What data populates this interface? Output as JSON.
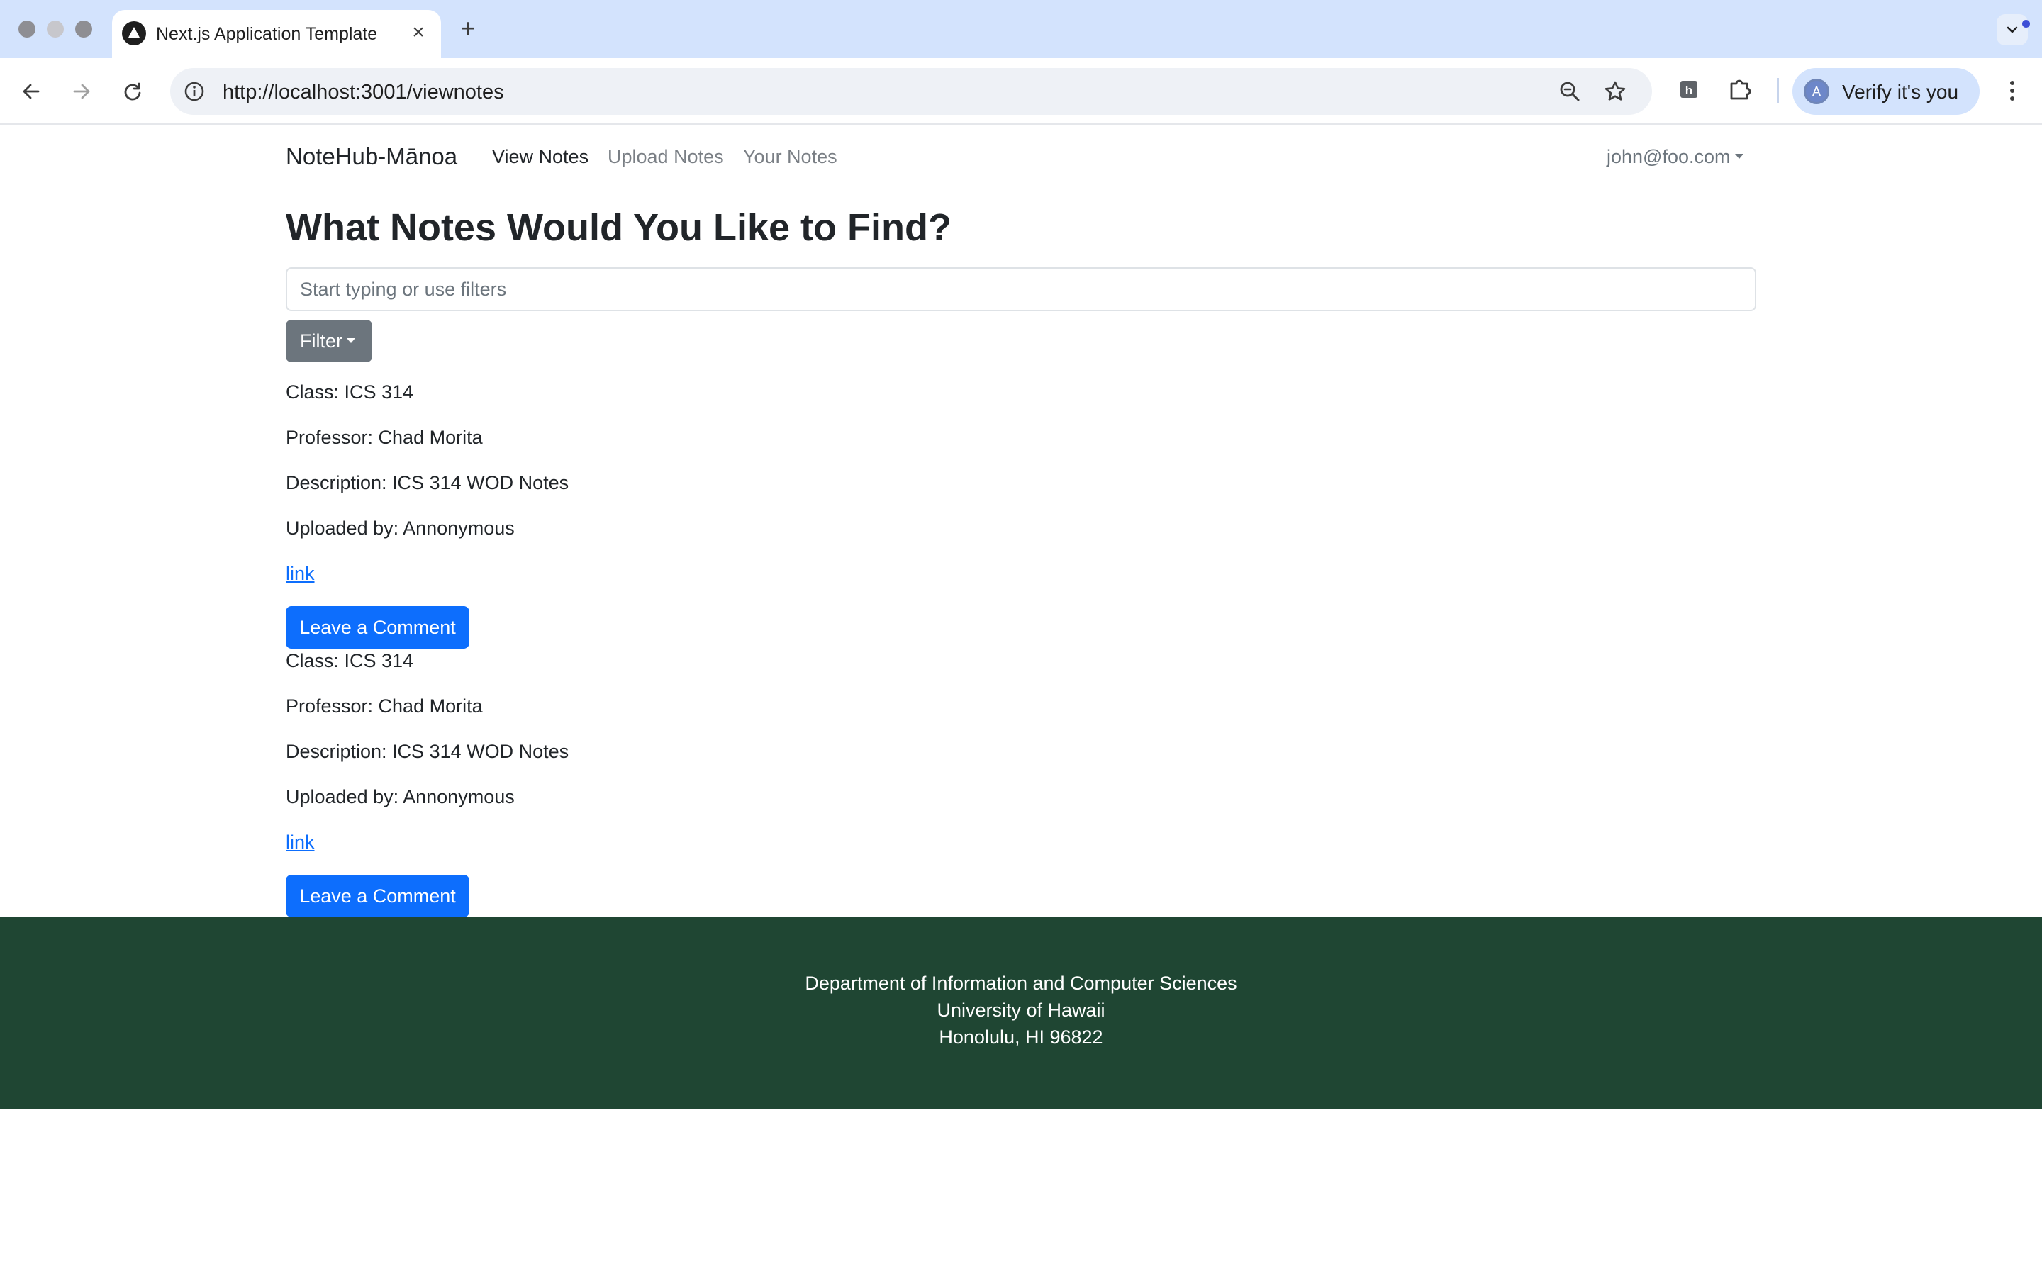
{
  "browser": {
    "tab_title": "Next.js Application Template",
    "url": "http://localhost:3001/viewnotes",
    "profile_label": "Verify it's you",
    "profile_initial": "A"
  },
  "navbar": {
    "brand": "NoteHub-Mānoa",
    "links": [
      "View Notes",
      "Upload Notes",
      "Your Notes"
    ],
    "active_link": "View Notes",
    "user": "john@foo.com"
  },
  "page": {
    "title": "What Notes Would You Like to Find?",
    "search_placeholder": "Start typing or use filters",
    "search_value": "",
    "filter_label": "Filter"
  },
  "notes": [
    {
      "class_line": "Class: ICS 314",
      "professor_line": "Professor: Chad Morita",
      "description_line": "Description: ICS 314 WOD Notes",
      "uploaded_line": "Uploaded by: Annonymous",
      "link_label": "link",
      "comment_label": "Leave a Comment"
    },
    {
      "class_line": "Class: ICS 314",
      "professor_line": "Professor: Chad Morita",
      "description_line": "Description: ICS 314 WOD Notes",
      "uploaded_line": "Uploaded by: Annonymous",
      "link_label": "link",
      "comment_label": "Leave a Comment"
    }
  ],
  "footer": {
    "lines": [
      "Department of Information and Computer Sciences",
      "University of Hawaii",
      "Honolulu, HI 96822"
    ]
  },
  "colors": {
    "primary_button": "#0d6efd",
    "secondary_button": "#6c757d",
    "footer_bg": "#1f4633",
    "tabbar_bg": "#d3e3fd"
  },
  "icons": [
    "back-icon",
    "forward-icon",
    "reload-icon",
    "site-info-icon",
    "zoom-icon",
    "bookmark-star-icon",
    "extension-icon",
    "tab-search-icon",
    "menu-icon"
  ]
}
